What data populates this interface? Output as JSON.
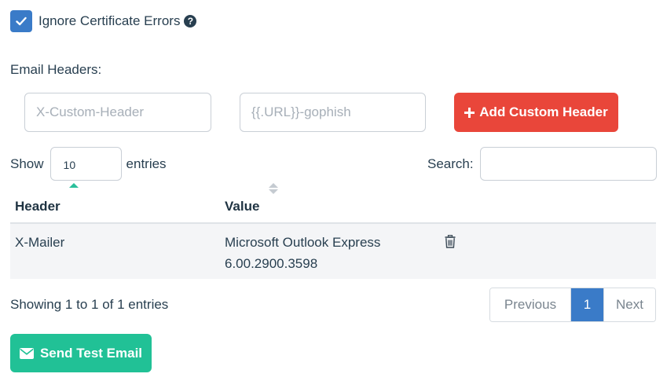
{
  "settings": {
    "ignore_cert_label": "Ignore Certificate Errors",
    "ignore_cert_checked": true,
    "help_icon": "question-circle-icon"
  },
  "email_headers": {
    "label": "Email Headers:",
    "key_placeholder": "X-Custom-Header",
    "value_placeholder": "{{.URL}}-gophish",
    "add_button_label": "Add Custom Header",
    "add_button_icon": "plus-icon"
  },
  "table_controls": {
    "show_label": "Show",
    "entries_label": "entries",
    "page_length": "10",
    "search_label": "Search:"
  },
  "table": {
    "columns": [
      "Header",
      "Value"
    ],
    "rows": [
      {
        "header": "X-Mailer",
        "value_line1": "Microsoft Outlook Express",
        "value_line2": "6.00.2900.3598",
        "action_icon": "trash-icon"
      }
    ]
  },
  "pagination": {
    "info": "Showing 1 to 1 of 1 entries",
    "previous": "Previous",
    "current": "1",
    "next": "Next"
  },
  "actions": {
    "send_test_label": "Send Test Email",
    "send_test_icon": "envelope-icon"
  },
  "colors": {
    "primary": "#3a7bc8",
    "danger": "#e9463a",
    "success": "#21c196",
    "text": "#283f50"
  }
}
